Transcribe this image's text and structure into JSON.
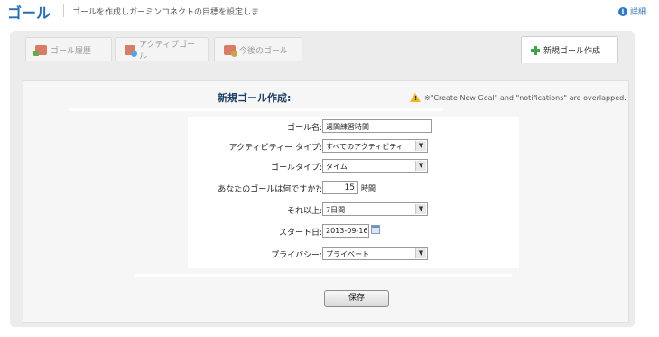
{
  "header": {
    "title": "ゴール",
    "subtitle": "ゴールを作成しガーミンコネクトの目標を設定しま",
    "details_label": "詳細"
  },
  "tabs": [
    {
      "label": "ゴール履歴"
    },
    {
      "label": "アクティブゴール"
    },
    {
      "label": "今後のゴール"
    },
    {
      "label": "新規ゴール作成"
    }
  ],
  "form": {
    "title": "新規ゴール作成:",
    "warning": "※\"Create New Goal\" and \"notifications\" are overlapped.",
    "goal_name": {
      "label": "ゴール名:",
      "value": "週間練習時間"
    },
    "activity_type": {
      "label": "アクティビティー タイプ:",
      "value": "すべてのアクティビティ"
    },
    "goal_type": {
      "label": "ゴールタイプ:",
      "value": "タイム"
    },
    "goal_amount": {
      "label": "あなたのゴールは何ですか?:",
      "value": "15",
      "unit": "時間"
    },
    "period": {
      "label": "それ以上:",
      "value": "7日間"
    },
    "start_date": {
      "label": "スタート日:",
      "value": "2013-09-16"
    },
    "privacy": {
      "label": "プライバシー:",
      "value": "プライベート"
    },
    "save_label": "保存"
  },
  "colors": {
    "accent": "#2a6fb0",
    "panel_bg": "#ececec",
    "warning": "#f0b62a",
    "plus": "#3fa34a"
  }
}
